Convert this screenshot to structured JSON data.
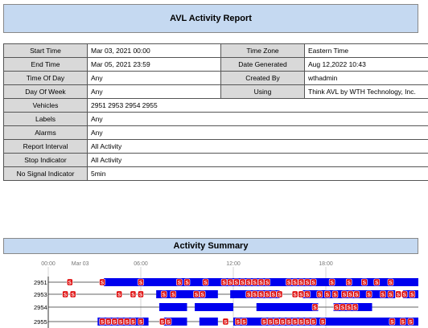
{
  "report": {
    "title": "AVL Activity Report"
  },
  "params_left": [
    {
      "label": "Start Time",
      "value": "Mar 03, 2021 00:00"
    },
    {
      "label": "End Time",
      "value": "Mar 05, 2021 23:59"
    },
    {
      "label": "Time Of Day",
      "value": "Any"
    },
    {
      "label": "Day Of Week",
      "value": "Any"
    },
    {
      "label": "Vehicles",
      "value": "2951  2953  2954  2955"
    },
    {
      "label": "Labels",
      "value": "Any"
    },
    {
      "label": "Alarms",
      "value": "Any"
    },
    {
      "label": "Report Interval",
      "value": "All  Activity"
    },
    {
      "label": "Stop Indicator",
      "value": "All  Activity"
    },
    {
      "label": "No Signal Indicator",
      "value": "5min"
    }
  ],
  "params_right": [
    {
      "label": "Time Zone",
      "value": "Eastern Time"
    },
    {
      "label": "Date Generated",
      "value": "Aug 12,2022 10:43"
    },
    {
      "label": "Created By",
      "value": "wthadmin"
    },
    {
      "label": "Using",
      "value": "Think AVL by WTH Technology, Inc."
    }
  ],
  "summary": {
    "title": "Activity Summary"
  },
  "chart_data": {
    "type": "timeline",
    "x_unit": "hour of day",
    "x_ticks": [
      {
        "hour": 0,
        "label": "00:00"
      },
      {
        "hour": 1.5,
        "label": "Mar 03"
      },
      {
        "hour": 6,
        "label": "06:00"
      },
      {
        "hour": 12,
        "label": "12:00"
      },
      {
        "hour": 18,
        "label": "18:00"
      }
    ],
    "xlim": [
      0,
      24
    ],
    "vehicles": [
      "2951",
      "2953",
      "2954",
      "2955"
    ],
    "stop_marker_label": "S",
    "colors": {
      "activity": "#0000ee",
      "stop": "#dd0000",
      "grid": "#bbbbbb"
    },
    "rows": [
      {
        "vehicle": "2951",
        "activity": [
          [
            3.6,
            24
          ]
        ],
        "stops": [
          1.4,
          3.5,
          6.0,
          8.5,
          9.0,
          10.2,
          11.4,
          11.8,
          12.2,
          12.6,
          13.0,
          13.4,
          13.8,
          14.2,
          15.6,
          16.0,
          16.4,
          16.8,
          17.2,
          18.4,
          19.5,
          20.5,
          21.3,
          22.2
        ]
      },
      {
        "vehicle": "2953",
        "activity": [
          [
            7.0,
            11.0
          ],
          [
            11.8,
            15.0
          ],
          [
            16.5,
            22.5
          ],
          [
            23.0,
            24.0
          ]
        ],
        "stops": [
          1.1,
          1.6,
          4.6,
          5.5,
          6.0,
          7.5,
          8.1,
          9.6,
          10.0,
          13.0,
          13.4,
          13.8,
          14.2,
          14.6,
          15.0,
          16.0,
          16.4,
          16.8,
          17.6,
          18.1,
          18.6,
          19.2,
          19.6,
          20.0,
          20.8,
          21.7,
          22.2,
          22.7,
          23.1,
          23.6
        ]
      },
      {
        "vehicle": "2954",
        "activity": [
          [
            7.2,
            9.0
          ],
          [
            9.5,
            12.0
          ],
          [
            13.5,
            17.5
          ],
          [
            18.5,
            21.0
          ]
        ],
        "stops": [
          17.3,
          18.7,
          19.1,
          19.5,
          19.9
        ]
      },
      {
        "vehicle": "2955",
        "activity": [
          [
            3.2,
            6.5
          ],
          [
            7.5,
            9.0
          ],
          [
            9.8,
            11.0
          ],
          [
            12.0,
            24.0
          ]
        ],
        "stops": [
          3.5,
          3.9,
          4.3,
          4.7,
          5.1,
          5.5,
          6.0,
          7.4,
          7.8,
          11.5,
          12.3,
          12.7,
          14.0,
          14.4,
          14.8,
          15.2,
          15.6,
          16.0,
          16.4,
          16.8,
          17.2,
          17.8,
          22.3,
          23.0,
          23.5
        ]
      }
    ]
  }
}
